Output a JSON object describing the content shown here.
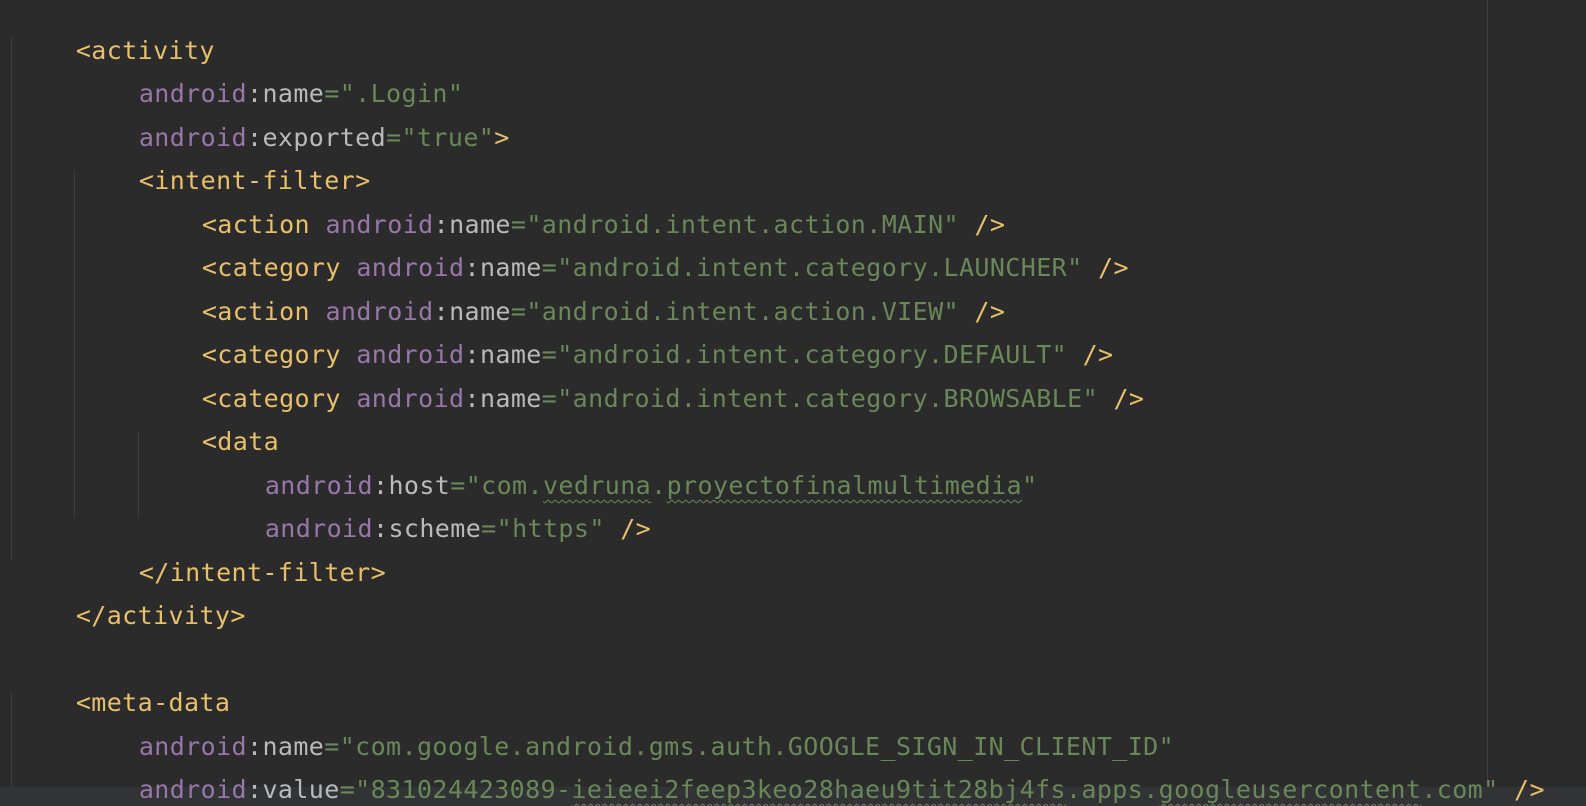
{
  "editor": {
    "language": "xml",
    "colors": {
      "background": "#2b2b2b",
      "tag": "#e8bf6a",
      "namespace": "#9876aa",
      "attribute": "#bababa",
      "value": "#6a8759"
    },
    "tokens": {
      "activity_open": "<activity",
      "activity_close": "</activity>",
      "intent_filter_open": "<intent-filter>",
      "intent_filter_close": "</intent-filter>",
      "action_open": "<action",
      "category_open": "<category",
      "data_open": "<data",
      "meta_data_open": "<meta-data",
      "self_close": " />",
      "tag_end": ">",
      "android": "android",
      "colon": ":",
      "equals": "=",
      "quote": "\"",
      "attr_name": "name",
      "attr_exported": "exported",
      "attr_host": "host",
      "attr_scheme": "scheme",
      "attr_value": "value"
    },
    "values": {
      "activity_name": ".Login",
      "activity_exported": "true",
      "action_main": "android.intent.action.MAIN",
      "category_launcher": "android.intent.category.LAUNCHER",
      "action_view": "android.intent.action.VIEW",
      "category_default": "android.intent.category.DEFAULT",
      "category_browsable": "android.intent.category.BROWSABLE",
      "host_prefix": "com.",
      "host_word1": "vedruna",
      "host_dot": ".",
      "host_word2": "proyectofinalmultimedia",
      "scheme": "https",
      "meta_name": "com.google.android.gms.auth.GOOGLE_SIGN_IN_CLIENT_ID",
      "meta_value_p1": "831024423089-",
      "meta_value_p2": "ieieei2feep3keo28haeu9tit28bj4fs",
      "meta_value_p3": ".apps.",
      "meta_value_p4": "googleusercontent",
      "meta_value_p5": ".com"
    }
  }
}
